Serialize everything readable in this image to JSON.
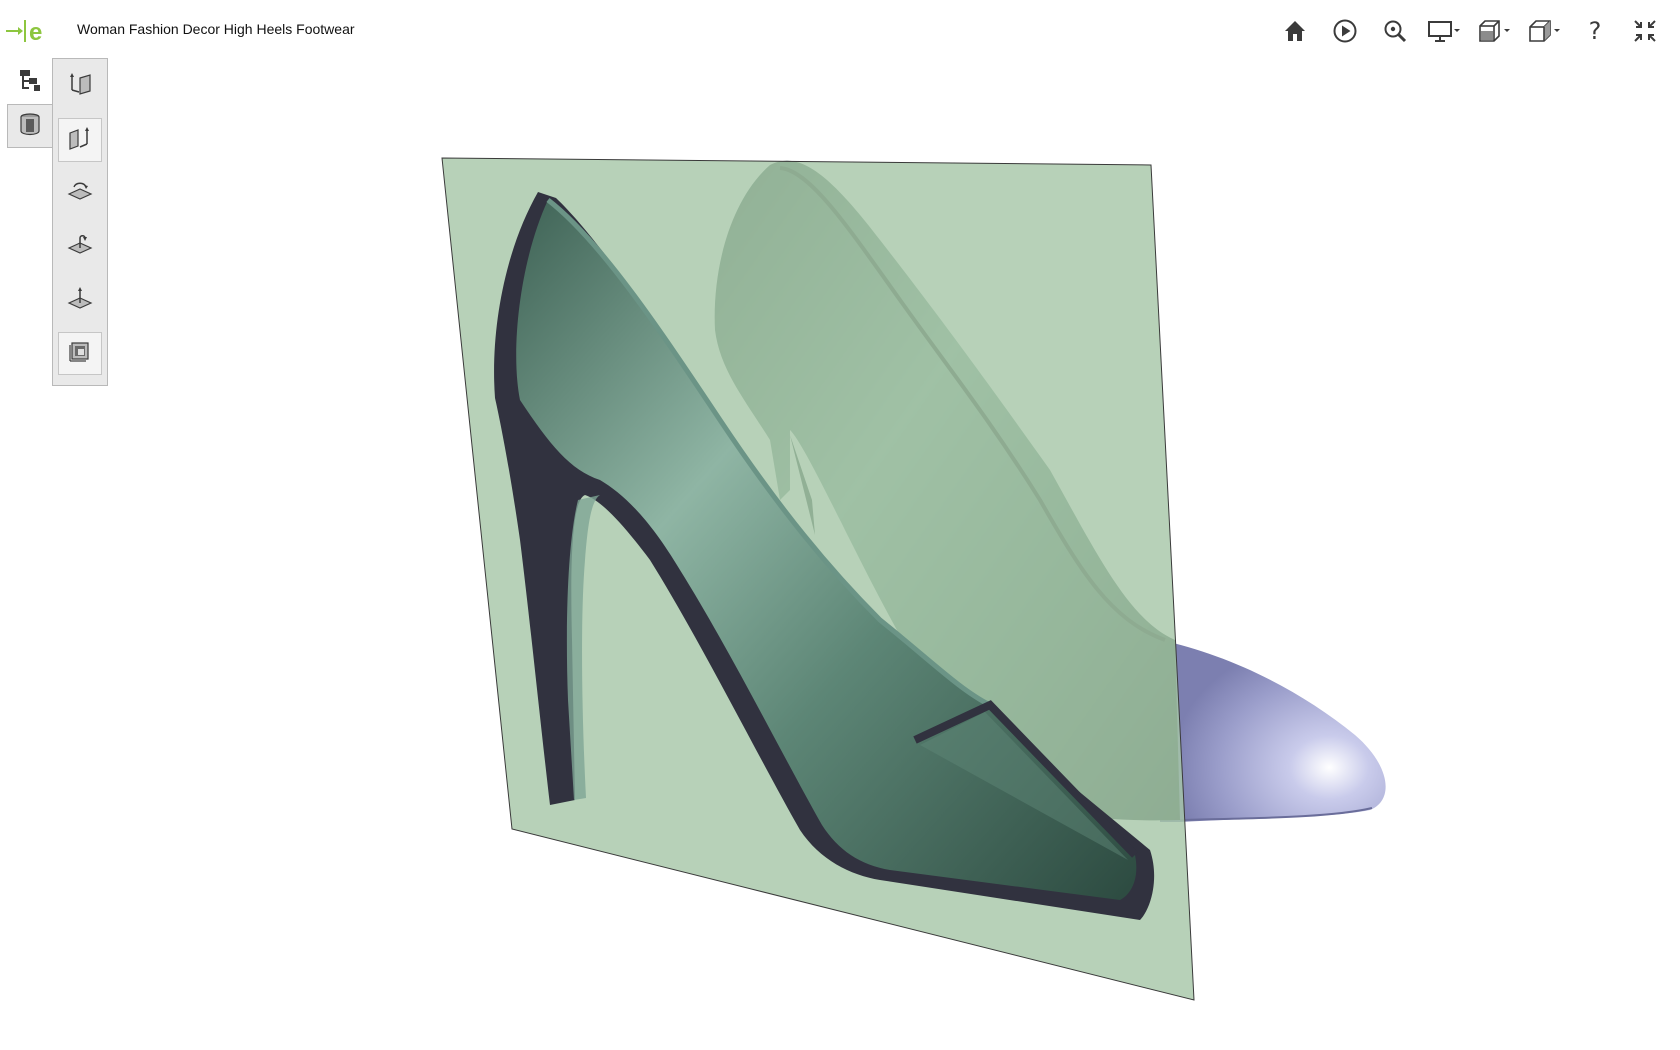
{
  "app": {
    "logo_icon": "eDrawings-logo-icon",
    "title": "Woman Fashion Decor High Heels Footwear",
    "accent_color": "#8dc63f"
  },
  "toolbar": {
    "items": [
      {
        "name": "home",
        "icon": "home-icon"
      },
      {
        "name": "play-animation",
        "icon": "play-icon"
      },
      {
        "name": "zoom-to-fit",
        "icon": "zoom-icon"
      },
      {
        "name": "display-style",
        "icon": "monitor-icon",
        "has_dropdown": true
      },
      {
        "name": "section-view",
        "icon": "section-view-icon",
        "has_dropdown": true
      },
      {
        "name": "view-orientation",
        "icon": "cube-icon",
        "has_dropdown": true
      },
      {
        "name": "help",
        "icon": "help-icon",
        "glyph": "?"
      },
      {
        "name": "exit-fullscreen",
        "icon": "collapse-icon"
      }
    ]
  },
  "side_tabs": [
    {
      "name": "model-tree",
      "icon": "tree-icon",
      "active": false
    },
    {
      "name": "section-tools",
      "icon": "section-cylinder-icon",
      "active": true
    }
  ],
  "section_tools": [
    {
      "name": "section-plane-xy",
      "icon": "xy-plane-icon"
    },
    {
      "name": "section-plane-yz",
      "icon": "yz-plane-icon",
      "selected": true
    },
    {
      "name": "section-plane-zx",
      "icon": "zx-plane-icon"
    },
    {
      "name": "flip-section",
      "icon": "flip-plane-icon"
    },
    {
      "name": "section-by-face",
      "icon": "normal-plane-icon"
    },
    {
      "name": "cap-section",
      "icon": "cap-icon",
      "selected": true
    }
  ],
  "scene": {
    "section_plane_color": "#b3cfb4",
    "shoe_color": "#6f9a88",
    "cut_face_color": "#31323f",
    "toe_color": "#b4b6dd"
  }
}
